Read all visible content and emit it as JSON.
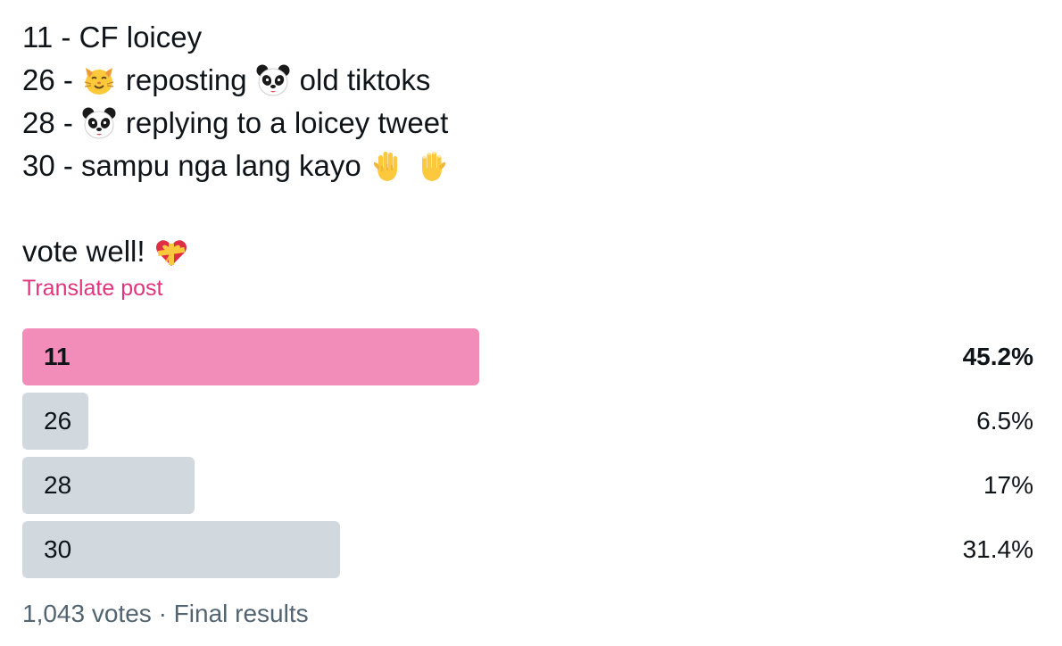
{
  "post": {
    "line1": {
      "text": "11 - CF loicey"
    },
    "line2": {
      "prefix": "26 -",
      "emoji1": "cat-face-emoji",
      "middle": "reposting",
      "emoji2": "panda-face-emoji",
      "suffix": "old tiktoks"
    },
    "line3": {
      "prefix": "28 -",
      "emoji1": "panda-face-emoji",
      "suffix": "replying to a loicey tweet"
    },
    "line4": {
      "text": "30 - sampu nga lang kayo",
      "emoji1": "raised-hand-emoji",
      "emoji2": "raised-back-of-hand-emoji"
    },
    "line5": {
      "text": "vote well!",
      "emoji1": "heart-with-ribbon-emoji"
    }
  },
  "translate_label": "Translate post",
  "poll": {
    "options": [
      {
        "label": "11",
        "percent_text": "45.2%",
        "percent": 45.2,
        "winner": true
      },
      {
        "label": "26",
        "percent_text": "6.5%",
        "percent": 6.5,
        "winner": false
      },
      {
        "label": "28",
        "percent_text": "17%",
        "percent": 17,
        "winner": false
      },
      {
        "label": "30",
        "percent_text": "31.4%",
        "percent": 31.4,
        "winner": false
      }
    ],
    "votes_text": "1,043 votes",
    "separator": "·",
    "status_text": "Final results"
  },
  "colors": {
    "winner_bar": "#f18db8",
    "other_bar": "#d2d9de",
    "link": "#e0357e",
    "muted_text": "#536471"
  }
}
